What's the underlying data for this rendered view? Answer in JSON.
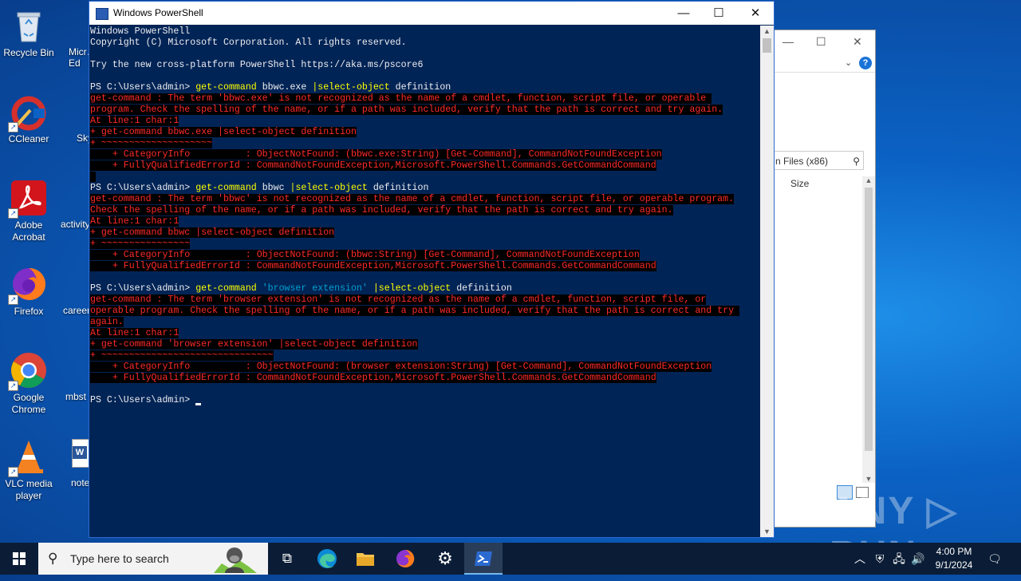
{
  "desktop": {
    "icons": [
      {
        "label": "Recycle Bin"
      },
      {
        "label": "CCleaner"
      },
      {
        "label": "Adobe Acrobat"
      },
      {
        "label": "Firefox"
      },
      {
        "label": "Google Chrome"
      },
      {
        "label": "VLC media player"
      }
    ],
    "partial_icons": [
      {
        "label": "Micr… Ed"
      },
      {
        "label": "Sky"
      },
      {
        "label": "activity"
      },
      {
        "label": "career"
      },
      {
        "label": "mbst"
      },
      {
        "label": "note"
      }
    ]
  },
  "explorer": {
    "search_text": "n Files (x86)",
    "column_size": "Size"
  },
  "powershell": {
    "title": "Windows PowerShell",
    "controls": {
      "minimize": "—",
      "maximize": "☐",
      "close": "✕"
    },
    "lines": [
      {
        "type": "out",
        "text": "Windows PowerShell"
      },
      {
        "type": "out",
        "text": "Copyright (C) Microsoft Corporation. All rights reserved."
      },
      {
        "type": "out",
        "text": ""
      },
      {
        "type": "out",
        "text": "Try the new cross-platform PowerShell https://aka.ms/pscore6"
      },
      {
        "type": "out",
        "text": ""
      },
      {
        "type": "prompt",
        "prompt": "PS C:\\Users\\admin> ",
        "cmd": "get-command",
        "arg": " bbwc.exe ",
        "pipe": "|select-object",
        "rest": " definition"
      },
      {
        "type": "err",
        "text": "get-command : The term 'bbwc.exe' is not recognized as the name of a cmdlet, function, script file, or operable "
      },
      {
        "type": "err",
        "text": "program. Check the spelling of the name, or if a path was included, verify that the path is correct and try again."
      },
      {
        "type": "err",
        "text": "At line:1 char:1"
      },
      {
        "type": "err",
        "text": "+ get-command bbwc.exe |select-object definition"
      },
      {
        "type": "err",
        "text": "+ ~~~~~~~~~~~~~~~~~~~~"
      },
      {
        "type": "err",
        "text": "    + CategoryInfo          : ObjectNotFound: (bbwc.exe:String) [Get-Command], CommandNotFoundException"
      },
      {
        "type": "err",
        "text": "    + FullyQualifiedErrorId : CommandNotFoundException,Microsoft.PowerShell.Commands.GetCommandCommand"
      },
      {
        "type": "err",
        "text": " "
      },
      {
        "type": "prompt",
        "prompt": "PS C:\\Users\\admin> ",
        "cmd": "get-command",
        "arg": " bbwc ",
        "pipe": "|select-object",
        "rest": " definition"
      },
      {
        "type": "err",
        "text": "get-command : The term 'bbwc' is not recognized as the name of a cmdlet, function, script file, or operable program."
      },
      {
        "type": "err",
        "text": "Check the spelling of the name, or if a path was included, verify that the path is correct and try again."
      },
      {
        "type": "err",
        "text": "At line:1 char:1"
      },
      {
        "type": "err",
        "text": "+ get-command bbwc |select-object definition"
      },
      {
        "type": "err",
        "text": "+ ~~~~~~~~~~~~~~~~"
      },
      {
        "type": "err",
        "text": "    + CategoryInfo          : ObjectNotFound: (bbwc:String) [Get-Command], CommandNotFoundException"
      },
      {
        "type": "err",
        "text": "    + FullyQualifiedErrorId : CommandNotFoundException,Microsoft.PowerShell.Commands.GetCommandCommand"
      },
      {
        "type": "out",
        "text": ""
      },
      {
        "type": "prompt",
        "prompt": "PS C:\\Users\\admin> ",
        "cmd": "get-command",
        "str": " 'browser extension' ",
        "pipe": "|select-object",
        "rest": " definition"
      },
      {
        "type": "err",
        "text": "get-command : The term 'browser extension' is not recognized as the name of a cmdlet, function, script file, or"
      },
      {
        "type": "err",
        "text": "operable program. Check the spelling of the name, or if a path was included, verify that the path is correct and try "
      },
      {
        "type": "err",
        "text": "again."
      },
      {
        "type": "err",
        "text": "At line:1 char:1"
      },
      {
        "type": "err",
        "text": "+ get-command 'browser extension' |select-object definition"
      },
      {
        "type": "err",
        "text": "+ ~~~~~~~~~~~~~~~~~~~~~~~~~~~~~~~"
      },
      {
        "type": "err",
        "text": "    + CategoryInfo          : ObjectNotFound: (browser extension:String) [Get-Command], CommandNotFoundException"
      },
      {
        "type": "err",
        "text": "    + FullyQualifiedErrorId : CommandNotFoundException,Microsoft.PowerShell.Commands.GetCommandCommand"
      },
      {
        "type": "out",
        "text": ""
      },
      {
        "type": "current",
        "prompt": "PS C:\\Users\\admin> "
      }
    ]
  },
  "watermark": "ANY ▷ RUN",
  "taskbar": {
    "search_placeholder": "Type here to search",
    "time": "4:00 PM",
    "date": "9/1/2024"
  }
}
